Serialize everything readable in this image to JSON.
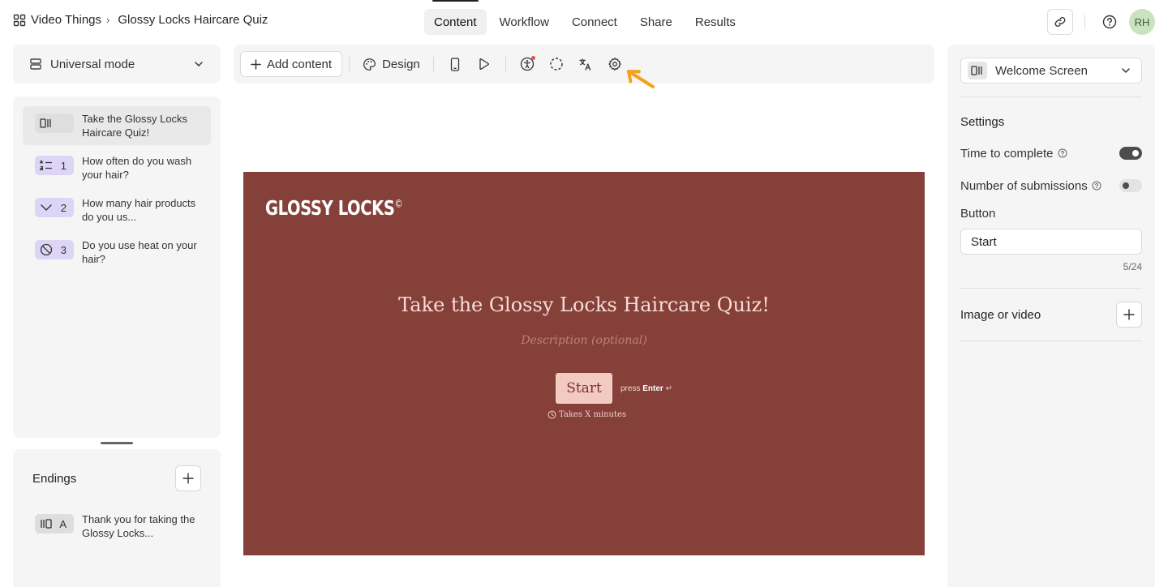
{
  "breadcrumb": {
    "workspace": "Video Things",
    "separator": "›",
    "form": "Glossy Locks Haircare Quiz"
  },
  "tabs": [
    {
      "label": "Content",
      "active": true
    },
    {
      "label": "Workflow"
    },
    {
      "label": "Connect"
    },
    {
      "label": "Share"
    },
    {
      "label": "Results"
    }
  ],
  "user": {
    "initials": "RH"
  },
  "mode": {
    "label": "Universal mode"
  },
  "questions": [
    {
      "badge_icon": "welcome-screen-icon",
      "number": "",
      "text": "Take the Glossy Locks Haircare Quiz!"
    },
    {
      "badge_icon": "ranking-icon",
      "number": "1",
      "text": "How often do you wash your hair?"
    },
    {
      "badge_icon": "dropdown-chevron-icon",
      "number": "2",
      "text": "How many hair products do you us..."
    },
    {
      "badge_icon": "no-heat-icon",
      "number": "3",
      "text": "Do you use heat on your hair?"
    }
  ],
  "endings": {
    "title": "Endings",
    "items": [
      {
        "letter": "A",
        "text": "Thank you for taking the Glossy Locks..."
      }
    ]
  },
  "toolbar": {
    "add_content": "Add content",
    "design": "Design"
  },
  "canvas": {
    "brand": "GLOSSY LOCKS",
    "brand_mark": "©",
    "title": "Take the Glossy Locks Haircare Quiz!",
    "description_placeholder": "Description (optional)",
    "start_label": "Start",
    "press_text": "press",
    "press_key": "Enter",
    "press_symbol": "↵",
    "time_text": "Takes X minutes"
  },
  "right_panel": {
    "screen_select": "Welcome Screen",
    "settings_title": "Settings",
    "time_to_complete": {
      "label": "Time to complete",
      "on": true
    },
    "number_of_submissions": {
      "label": "Number of submissions",
      "on": false
    },
    "button_label": "Button",
    "button_value": "Start",
    "button_counter": "5/24",
    "image_or_video": "Image or video"
  },
  "colors": {
    "canvas_bg": "#86403a",
    "canvas_title": "#f7dcd6",
    "start_button": "#f3cac2",
    "annotation_arrow": "#f4a21d",
    "avatar_bg": "#c9e3c1",
    "question_badge": "#ddd5f5"
  }
}
